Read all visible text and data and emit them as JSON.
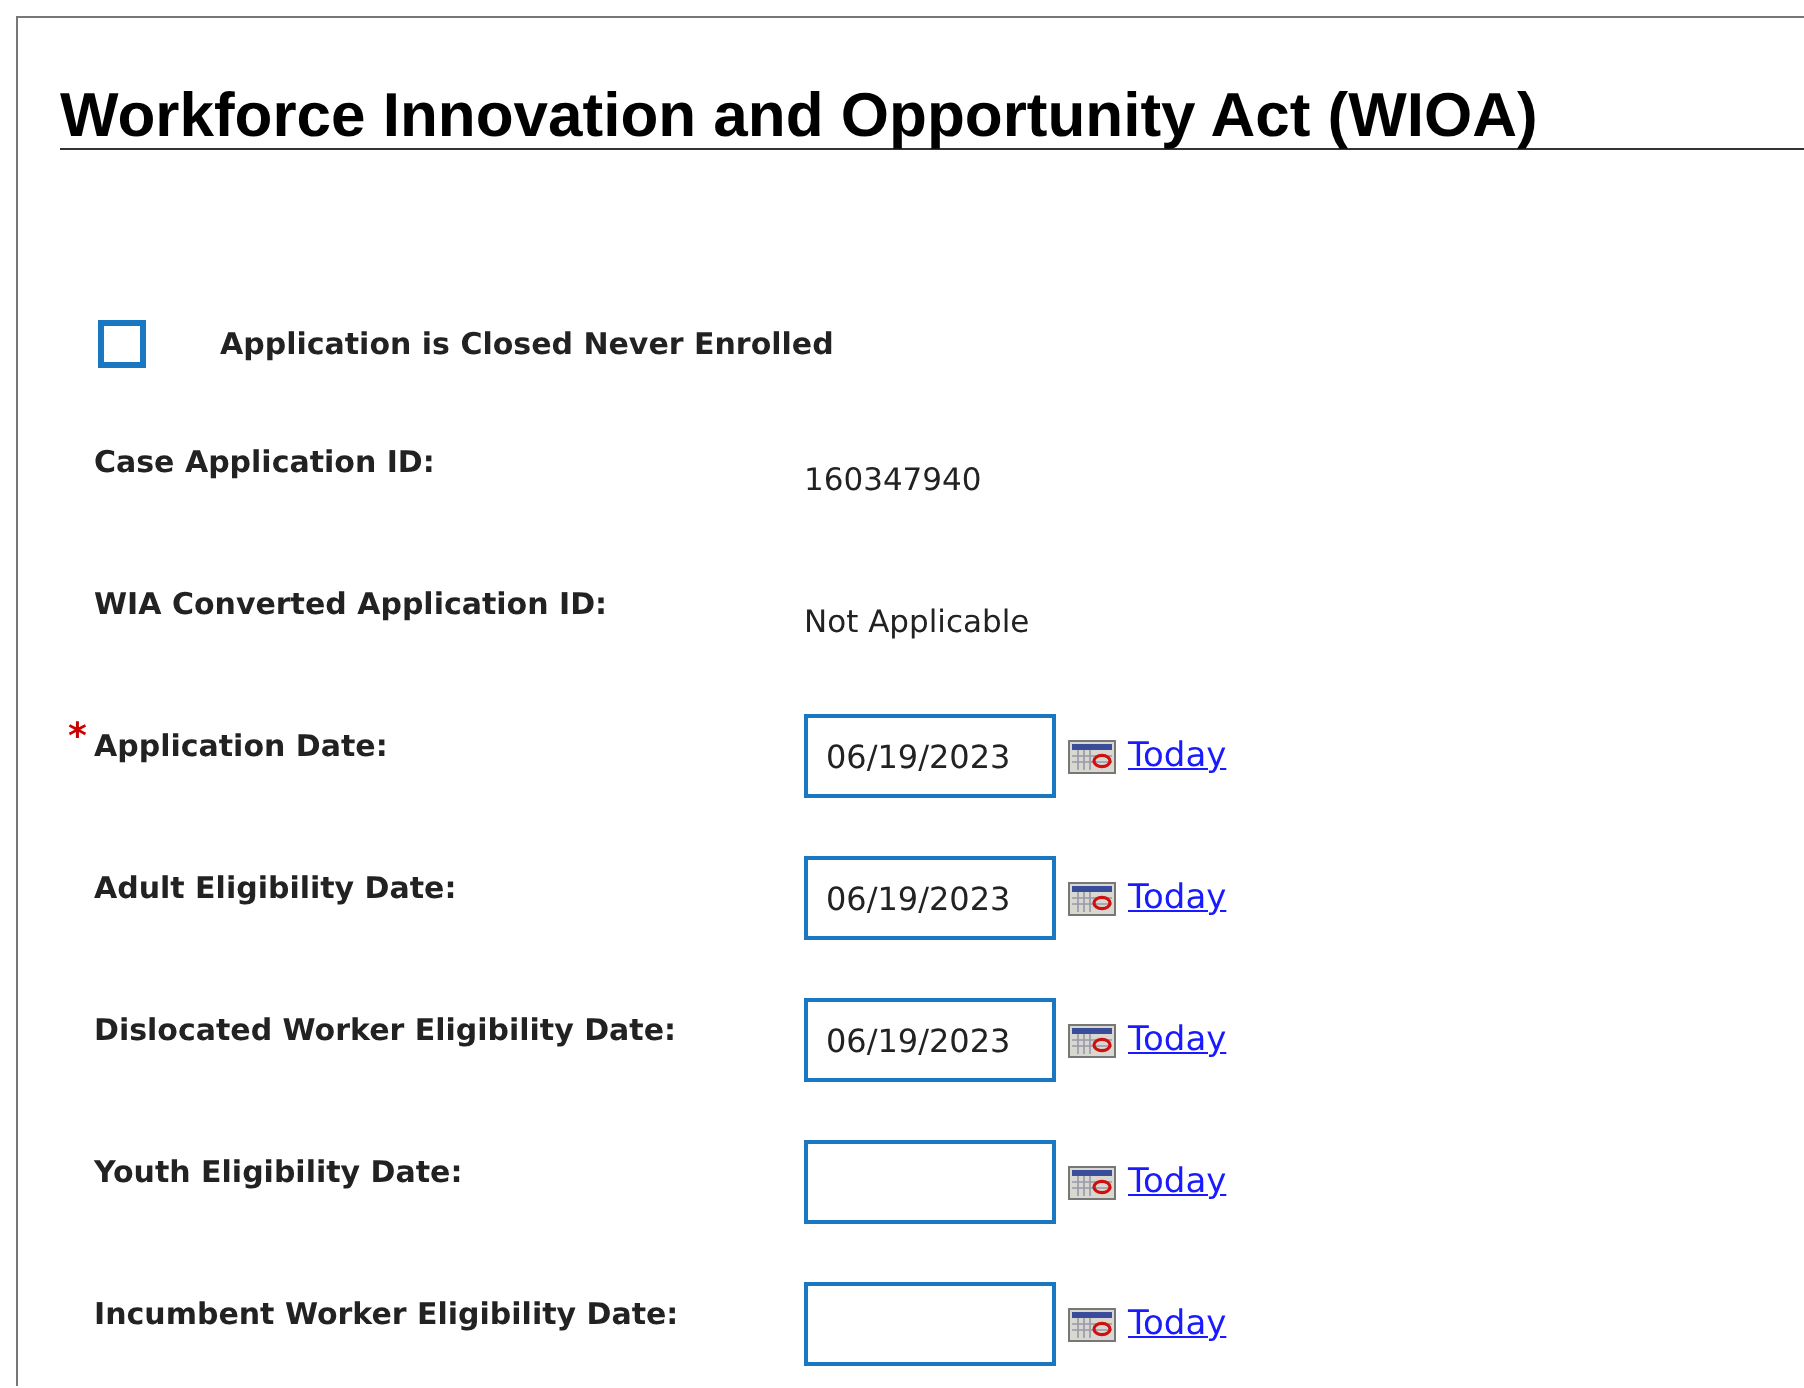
{
  "title": "Workforce Innovation and Opportunity Act (WIOA)",
  "closed_checkbox": {
    "label": "Application is Closed Never Enrolled",
    "checked": false
  },
  "required_mark": "*",
  "fields": [
    {
      "kind": "text",
      "label": "Case Application ID:",
      "required": false,
      "value": "160347940"
    },
    {
      "kind": "text",
      "label": "WIA Converted Application ID:",
      "required": false,
      "value": "Not Applicable"
    },
    {
      "kind": "date",
      "label": "Application Date:",
      "required": true,
      "value": "06/19/2023",
      "link": "Today"
    },
    {
      "kind": "date",
      "label": "Adult Eligibility Date:",
      "required": false,
      "value": "06/19/2023",
      "link": "Today"
    },
    {
      "kind": "date",
      "label": "Dislocated Worker Eligibility Date:",
      "required": false,
      "value": "06/19/2023",
      "link": "Today"
    },
    {
      "kind": "date",
      "label": "Youth Eligibility Date:",
      "required": false,
      "link": "Today"
    },
    {
      "kind": "date",
      "label": "Incumbent Worker Eligibility Date:",
      "required": false,
      "link": "Today"
    }
  ]
}
